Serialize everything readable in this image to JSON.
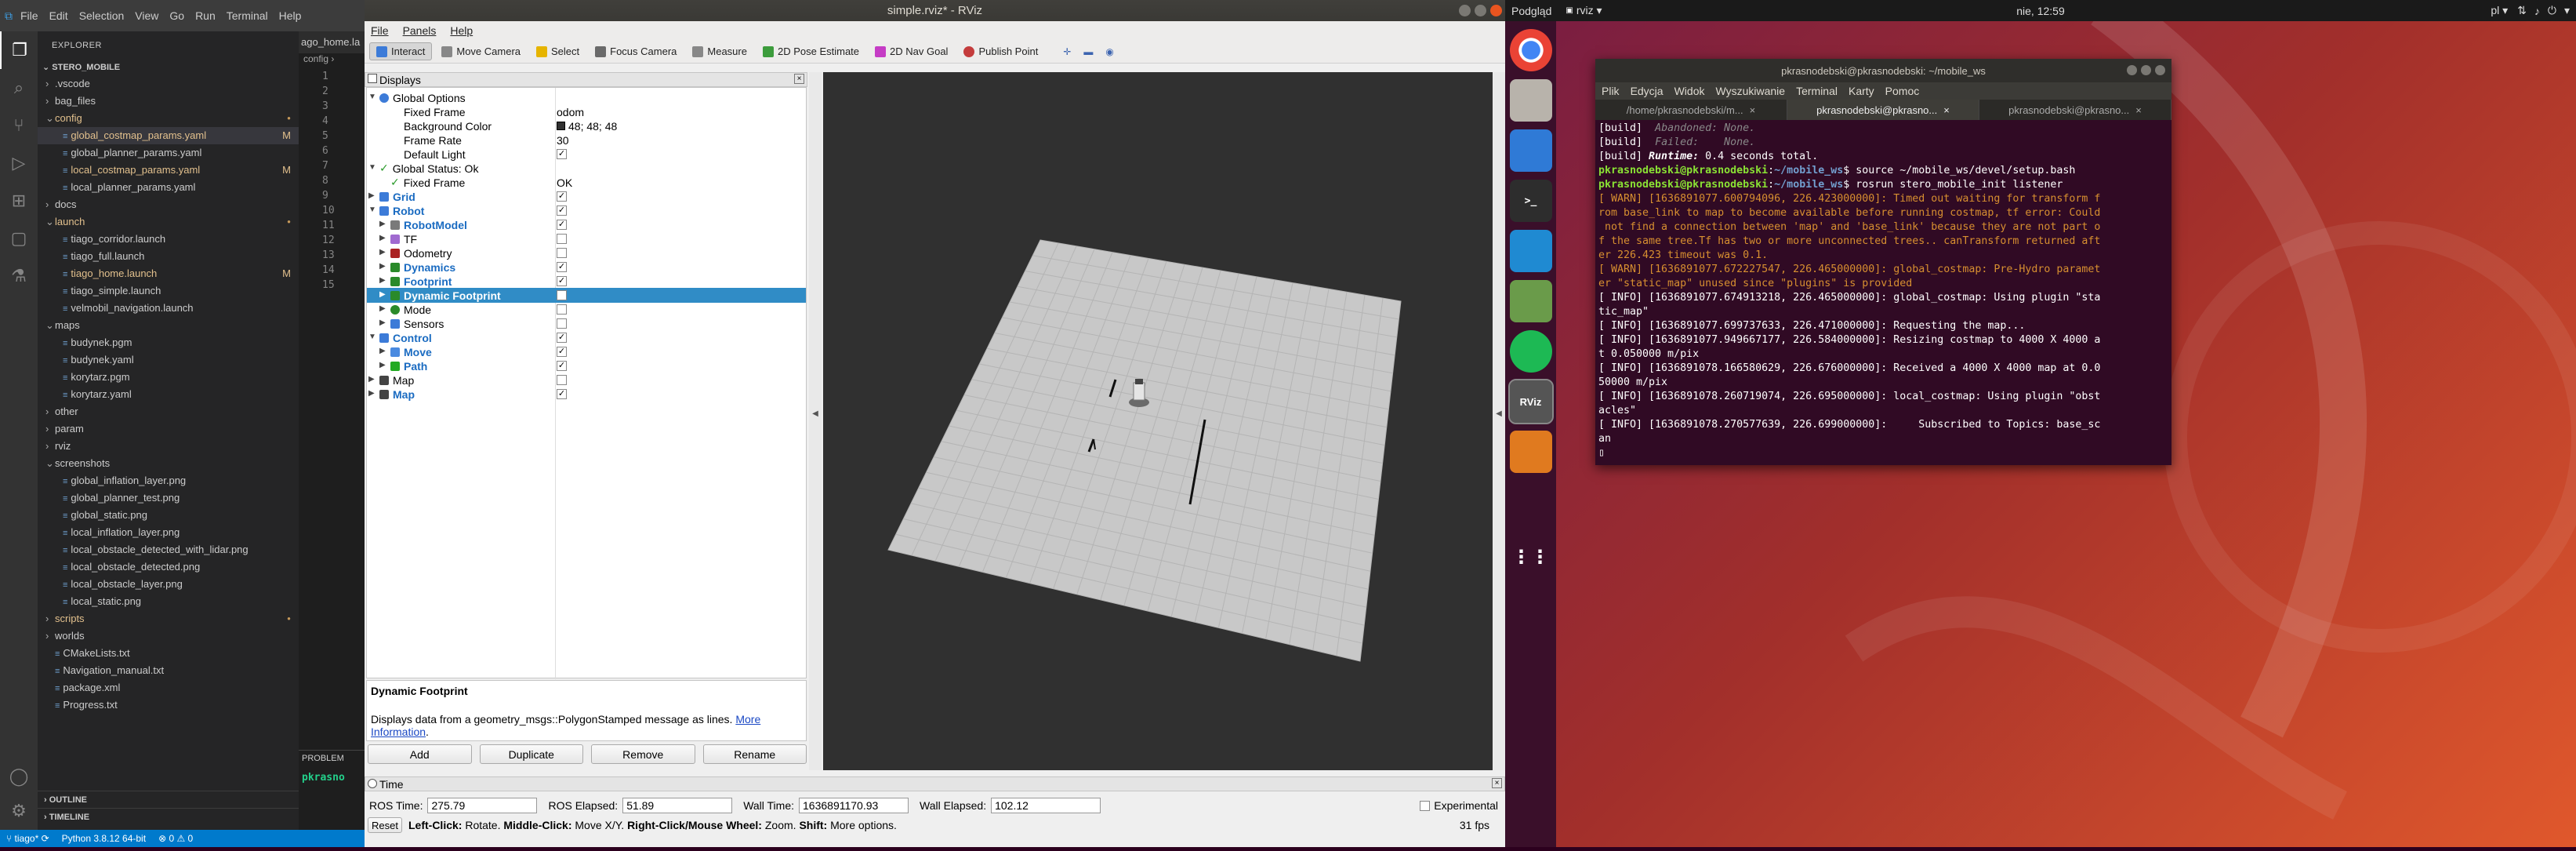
{
  "vscode": {
    "menu": [
      "File",
      "Edit",
      "Selection",
      "View",
      "Go",
      "Run",
      "Terminal",
      "Help"
    ],
    "explorer_title": "EXPLORER",
    "project": "STERO_MOBILE",
    "tab": "ago_home.la",
    "breadcrumb": "config",
    "tree": [
      {
        "t": ".vscode",
        "d": 1,
        "k": "folder"
      },
      {
        "t": "bag_files",
        "d": 1,
        "k": "folder"
      },
      {
        "t": "config",
        "d": 1,
        "k": "open",
        "m": true
      },
      {
        "t": "global_costmap_params.yaml",
        "d": 2,
        "m": true,
        "badge": "M",
        "sel": true
      },
      {
        "t": "global_planner_params.yaml",
        "d": 2
      },
      {
        "t": "local_costmap_params.yaml",
        "d": 2,
        "m": true,
        "badge": "M"
      },
      {
        "t": "local_planner_params.yaml",
        "d": 2
      },
      {
        "t": "docs",
        "d": 1,
        "k": "folder"
      },
      {
        "t": "launch",
        "d": 1,
        "k": "open",
        "m": true
      },
      {
        "t": "tiago_corridor.launch",
        "d": 2
      },
      {
        "t": "tiago_full.launch",
        "d": 2
      },
      {
        "t": "tiago_home.launch",
        "d": 2,
        "m": true,
        "badge": "M"
      },
      {
        "t": "tiago_simple.launch",
        "d": 2
      },
      {
        "t": "velmobil_navigation.launch",
        "d": 2
      },
      {
        "t": "maps",
        "d": 1,
        "k": "open"
      },
      {
        "t": "budynek.pgm",
        "d": 2
      },
      {
        "t": "budynek.yaml",
        "d": 2
      },
      {
        "t": "korytarz.pgm",
        "d": 2
      },
      {
        "t": "korytarz.yaml",
        "d": 2
      },
      {
        "t": "other",
        "d": 1,
        "k": "folder"
      },
      {
        "t": "param",
        "d": 1,
        "k": "folder"
      },
      {
        "t": "rviz",
        "d": 1,
        "k": "folder"
      },
      {
        "t": "screenshots",
        "d": 1,
        "k": "open"
      },
      {
        "t": "global_inflation_layer.png",
        "d": 2
      },
      {
        "t": "global_planner_test.png",
        "d": 2
      },
      {
        "t": "global_static.png",
        "d": 2
      },
      {
        "t": "local_inflation_layer.png",
        "d": 2
      },
      {
        "t": "local_obstacle_detected_with_lidar.png",
        "d": 2
      },
      {
        "t": "local_obstacle_detected.png",
        "d": 2
      },
      {
        "t": "local_obstacle_layer.png",
        "d": 2
      },
      {
        "t": "local_static.png",
        "d": 2
      },
      {
        "t": "scripts",
        "d": 1,
        "k": "folder",
        "m": true
      },
      {
        "t": "worlds",
        "d": 1,
        "k": "folder"
      },
      {
        "t": "CMakeLists.txt",
        "d": 1
      },
      {
        "t": "Navigation_manual.txt",
        "d": 1
      },
      {
        "t": "package.xml",
        "d": 1
      },
      {
        "t": "Progress.txt",
        "d": 1
      }
    ],
    "line_numbers": [
      "1",
      "2",
      "3",
      "4",
      "5",
      "6",
      "7",
      "8",
      "9",
      "10",
      "11",
      "12",
      "13",
      "14",
      "15"
    ],
    "outline": "OUTLINE",
    "timeline": "TIMELINE",
    "problems": "PROBLEM",
    "term_snip": "pkrasno",
    "status": [
      "tiago*",
      "Python 3.8.12 64-bit",
      "⊗ 0 ⚠ 0"
    ]
  },
  "rviz": {
    "title": "simple.rviz* - RViz",
    "menu": [
      "File",
      "Panels",
      "Help"
    ],
    "tools": [
      "Interact",
      "Move Camera",
      "Select",
      "Focus Camera",
      "Measure",
      "2D Pose Estimate",
      "2D Nav Goal",
      "Publish Point"
    ],
    "displays_title": "Displays",
    "rows": [
      {
        "n": "Global Options",
        "d": 1,
        "exp": "open",
        "icon": "gear"
      },
      {
        "n": "Fixed Frame",
        "d": 2,
        "v": "odom"
      },
      {
        "n": "Background Color",
        "d": 2,
        "v": "48; 48; 48",
        "sw": true
      },
      {
        "n": "Frame Rate",
        "d": 2,
        "v": "30"
      },
      {
        "n": "Default Light",
        "d": 2,
        "c": true
      },
      {
        "n": "Global Status: Ok",
        "d": 1,
        "exp": "open",
        "icon": "ok"
      },
      {
        "n": "Fixed Frame",
        "d": 2,
        "v": "OK",
        "icon": "ok"
      },
      {
        "n": "Grid",
        "d": 1,
        "exp": "closed",
        "b": true,
        "c": true,
        "icon": "grid"
      },
      {
        "n": "Robot",
        "d": 1,
        "exp": "open",
        "b": true,
        "c": true,
        "icon": "folder"
      },
      {
        "n": "RobotModel",
        "d": 2,
        "exp": "closed",
        "b": true,
        "c": true,
        "icon": "robot"
      },
      {
        "n": "TF",
        "d": 2,
        "exp": "closed",
        "c": false,
        "icon": "tf"
      },
      {
        "n": "Odometry",
        "d": 2,
        "exp": "closed",
        "c": false,
        "icon": "odo"
      },
      {
        "n": "Dynamics",
        "d": 2,
        "exp": "closed",
        "b": true,
        "c": true,
        "icon": "dyn"
      },
      {
        "n": "Footprint",
        "d": 2,
        "exp": "closed",
        "b": true,
        "c": true,
        "icon": "fp"
      },
      {
        "n": "Dynamic Footprint",
        "d": 2,
        "exp": "closed",
        "b": true,
        "c": true,
        "sel": true,
        "icon": "fp"
      },
      {
        "n": "Mode",
        "d": 2,
        "exp": "closed",
        "c": false,
        "icon": "mode"
      },
      {
        "n": "Sensors",
        "d": 2,
        "exp": "closed",
        "c": false,
        "icon": "folder"
      },
      {
        "n": "Control",
        "d": 1,
        "exp": "open",
        "b": true,
        "c": true,
        "icon": "folder"
      },
      {
        "n": "Move",
        "d": 2,
        "exp": "closed",
        "b": true,
        "c": true,
        "icon": "move"
      },
      {
        "n": "Path",
        "d": 2,
        "exp": "closed",
        "b": true,
        "c": true,
        "icon": "path"
      },
      {
        "n": "Map",
        "d": 1,
        "exp": "closed",
        "c": false,
        "icon": "map"
      },
      {
        "n": "Map",
        "d": 1,
        "exp": "closed",
        "b": true,
        "c": true,
        "icon": "map"
      }
    ],
    "desc_title": "Dynamic Footprint",
    "desc_text": "Displays data from a geometry_msgs::PolygonStamped message as lines.",
    "desc_link1": "More",
    "desc_link2": "Information",
    "buttons": [
      "Add",
      "Duplicate",
      "Remove",
      "Rename"
    ],
    "time_title": "Time",
    "ros_time_label": "ROS Time:",
    "ros_time": "275.79",
    "ros_elapsed_label": "ROS Elapsed:",
    "ros_elapsed": "51.89",
    "wall_time_label": "Wall Time:",
    "wall_time": "1636891170.93",
    "wall_elapsed_label": "Wall Elapsed:",
    "wall_elapsed": "102.12",
    "experimental": "Experimental",
    "reset": "Reset",
    "help_b1": "Left-Click:",
    "help_t1": " Rotate. ",
    "help_b2": "Middle-Click:",
    "help_t2": " Move X/Y. ",
    "help_b3": "Right-Click/Mouse Wheel:",
    "help_t3": " Zoom. ",
    "help_b4": "Shift:",
    "help_t4": " More options.",
    "fps": "31 fps",
    "bg_color": "#303030"
  },
  "ubuntu": {
    "app": "Podgląd",
    "rviz_app": "rviz ▾",
    "clock": "nie, 12:59",
    "lang": "pl ▾",
    "dock": [
      "chrome",
      "files",
      "docs",
      "terminal",
      "vscode",
      "viewer",
      "spotify",
      "rviz",
      "layers",
      "apps"
    ],
    "dock_labels": {
      "terminal": ">_",
      "rviz": "RViz"
    }
  },
  "terminal": {
    "title": "pkrasnodebski@pkrasnodebski: ~/mobile_ws",
    "menu": [
      "Plik",
      "Edycja",
      "Widok",
      "Wyszukiwanie",
      "Terminal",
      "Karty",
      "Pomoc"
    ],
    "tabs": [
      "/home/pkrasnodebski/m...",
      "pkrasnodebski@pkrasno...",
      "pkrasnodebski@pkrasno..."
    ],
    "lines": [
      {
        "c": "",
        "t": "[build]  ",
        "i": "Abandoned: None."
      },
      {
        "c": "",
        "t": "[build]  ",
        "i": "Failed:    None."
      },
      {
        "c": "",
        "t": "[build] ",
        "b": "Runtime:",
        "r": " 0.4 seconds total."
      },
      {
        "c": "p",
        "u": "pkrasnodebski@pkrasnodebski",
        "p": "~/mobile_ws",
        "r": "$ source ~/mobile_ws/devel/setup.bash"
      },
      {
        "c": "p",
        "u": "pkrasnodebski@pkrasnodebski",
        "p": "~/mobile_ws",
        "r": "$ rosrun stero_mobile_init listener"
      },
      {
        "c": "w",
        "t": "[ WARN] [1636891077.600794096, 226.423000000]: Timed out waiting for transform f"
      },
      {
        "c": "w",
        "t": "rom base_link to map to become available before running costmap, tf error: Could"
      },
      {
        "c": "w",
        "t": " not find a connection between 'map' and 'base_link' because they are not part o"
      },
      {
        "c": "w",
        "t": "f the same tree.Tf has two or more unconnected trees.. canTransform returned aft"
      },
      {
        "c": "w",
        "t": "er 226.423 timeout was 0.1."
      },
      {
        "c": "w",
        "t": "[ WARN] [1636891077.672227547, 226.465000000]: global_costmap: Pre-Hydro paramet"
      },
      {
        "c": "w",
        "t": "er \"static_map\" unused since \"plugins\" is provided"
      },
      {
        "c": "",
        "t": "[ INFO] [1636891077.674913218, 226.465000000]: global_costmap: Using plugin \"sta"
      },
      {
        "c": "",
        "t": "tic_map\""
      },
      {
        "c": "",
        "t": "[ INFO] [1636891077.699737633, 226.471000000]: Requesting the map..."
      },
      {
        "c": "",
        "t": "[ INFO] [1636891077.949667177, 226.584000000]: Resizing costmap to 4000 X 4000 a"
      },
      {
        "c": "",
        "t": "t 0.050000 m/pix"
      },
      {
        "c": "",
        "t": "[ INFO] [1636891078.166580629, 226.676000000]: Received a 4000 X 4000 map at 0.0"
      },
      {
        "c": "",
        "t": "50000 m/pix"
      },
      {
        "c": "",
        "t": "[ INFO] [1636891078.260719074, 226.695000000]: local_costmap: Using plugin \"obst"
      },
      {
        "c": "",
        "t": "acles\""
      },
      {
        "c": "",
        "t": "[ INFO] [1636891078.270577639, 226.699000000]:     Subscribed to Topics: base_sc"
      },
      {
        "c": "",
        "t": "an"
      }
    ]
  }
}
